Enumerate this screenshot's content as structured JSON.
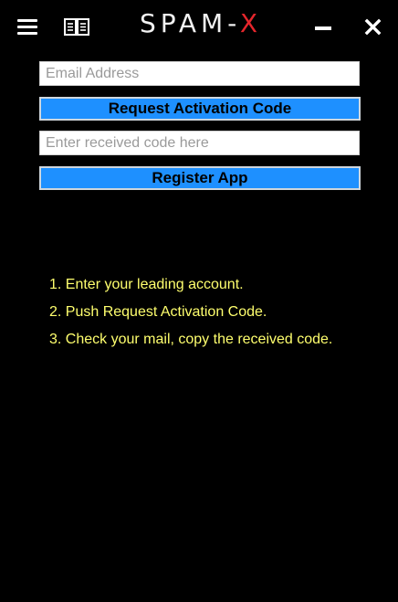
{
  "app": {
    "title_main": "SPAM-",
    "title_accent": "X",
    "accent_color": "#e5262c"
  },
  "titlebar": {
    "icons": [
      "menu-icon",
      "book-icon",
      "minimize-icon",
      "close-icon"
    ]
  },
  "form": {
    "email_placeholder": "Email Address",
    "email_value": "",
    "request_button_label": "Request Activation Code",
    "code_placeholder": "Enter received code here",
    "code_value": "",
    "register_button_label": "Register App",
    "button_color": "#1e90ff"
  },
  "instructions": {
    "color": "#ffff6e",
    "steps": [
      "1. Enter your leading account.",
      "2. Push Request Activation Code.",
      "3. Check your mail, copy the received code."
    ]
  }
}
